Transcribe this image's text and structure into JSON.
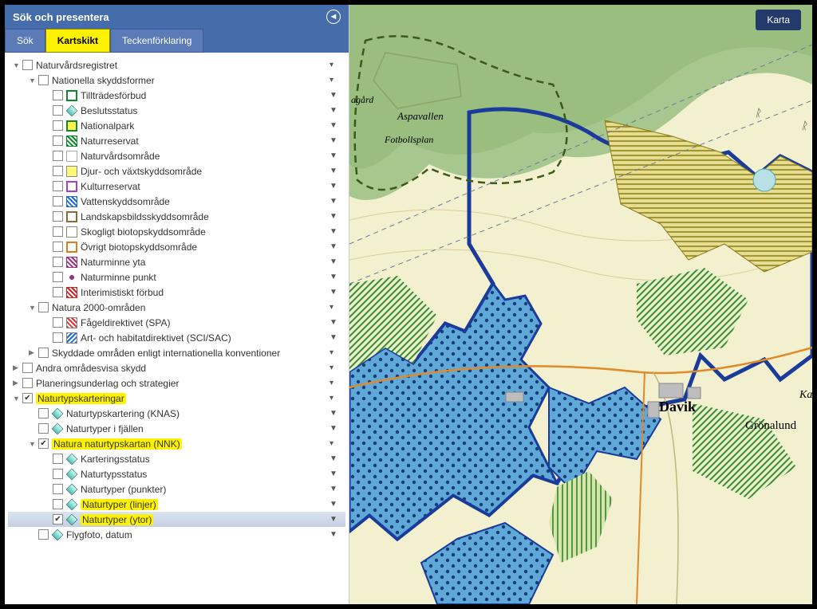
{
  "panel": {
    "title": "Sök och presentera",
    "tabs": {
      "search": "Sök",
      "layers": "Kartskikt",
      "legend": "Teckenförklaring"
    }
  },
  "map": {
    "button": "Karta",
    "labels": {
      "aspavallen": "Aspavallen",
      "fotbollsplan": "Fotbollsplan",
      "davik": "Davik",
      "gronalund": "Grönalund",
      "ka": "Ka",
      "agard": "agård"
    }
  },
  "tree": [
    {
      "lvl": 0,
      "caret": "▼",
      "label": "Naturvårdsregistret",
      "cb": false,
      "sym": "",
      "opts": "▾"
    },
    {
      "lvl": 1,
      "caret": "▼",
      "label": "Nationella skyddsformer",
      "cb": false,
      "sym": "",
      "opts": "▾"
    },
    {
      "lvl": 2,
      "caret": "",
      "label": "Tillträdesförbud",
      "cb": false,
      "sym": "box-green",
      "opts": "▼",
      "symStyle": "background:#fff;border:2px solid #0a8a2a;"
    },
    {
      "lvl": 2,
      "caret": "",
      "label": "Beslutsstatus",
      "cb": false,
      "sym": "diamond",
      "opts": "▼"
    },
    {
      "lvl": 2,
      "caret": "",
      "label": "Nationalpark",
      "cb": false,
      "sym": "box",
      "opts": "▼",
      "symStyle": "background:#fff34a;border:2px solid #0a8a2a;"
    },
    {
      "lvl": 2,
      "caret": "",
      "label": "Naturreservat",
      "cb": false,
      "sym": "box",
      "opts": "▼",
      "symStyle": "background:repeating-linear-gradient(45deg,#0a8a2a 0 2px,#fff 2px 4px);border:1px solid #0a8a2a;"
    },
    {
      "lvl": 2,
      "caret": "",
      "label": "Naturvårdsområde",
      "cb": false,
      "sym": "box",
      "opts": "▼",
      "symStyle": "background:#fff;border:1px solid #aaa;"
    },
    {
      "lvl": 2,
      "caret": "",
      "label": "Djur- och växtskyddsområde",
      "cb": false,
      "sym": "box",
      "opts": "▼",
      "symStyle": "background:#fff97a;"
    },
    {
      "lvl": 2,
      "caret": "",
      "label": "Kulturreservat",
      "cb": false,
      "sym": "box",
      "opts": "▼",
      "symStyle": "background:#fff;border:2px solid #a040d0;"
    },
    {
      "lvl": 2,
      "caret": "",
      "label": "Vattenskyddsområde",
      "cb": false,
      "sym": "box",
      "opts": "▼",
      "symStyle": "background:repeating-linear-gradient(45deg,#1a6ad9 0 2px,#fff 2px 4px);border:1px solid #1a6ad9;"
    },
    {
      "lvl": 2,
      "caret": "",
      "label": "Landskapsbildsskyddsområde",
      "cb": false,
      "sym": "box",
      "opts": "▼",
      "symStyle": "background:#fff;border:2px solid #8a6a3a;"
    },
    {
      "lvl": 2,
      "caret": "",
      "label": "Skogligt biotopskyddsområde",
      "cb": false,
      "sym": "box",
      "opts": "▼",
      "symStyle": "background:#fff;border:1px solid #887;"
    },
    {
      "lvl": 2,
      "caret": "",
      "label": "Övrigt biotopskyddsområde",
      "cb": false,
      "sym": "box",
      "opts": "▼",
      "symStyle": "background:#fff;border:2px solid #e07a1a;"
    },
    {
      "lvl": 2,
      "caret": "",
      "label": "Naturminne yta",
      "cb": false,
      "sym": "box",
      "opts": "▼",
      "symStyle": "background:repeating-linear-gradient(45deg,#a03080 0 2px,#fff 2px 4px);border:1px solid #a03080;"
    },
    {
      "lvl": 2,
      "caret": "",
      "label": "Naturminne punkt",
      "cb": false,
      "sym": "dot",
      "opts": "▼",
      "symStyle": "background:radial-gradient(circle,#a03080 0 3px,transparent 3px);border:none;"
    },
    {
      "lvl": 2,
      "caret": "",
      "label": "Interimistiskt förbud",
      "cb": false,
      "sym": "box",
      "opts": "▼",
      "symStyle": "background:repeating-linear-gradient(45deg,#c22 0 2px,#fff 2px 4px);border:1px solid #c22;"
    },
    {
      "lvl": 1,
      "caret": "▼",
      "label": "Natura 2000-områden",
      "cb": false,
      "sym": "",
      "opts": "▾"
    },
    {
      "lvl": 2,
      "caret": "",
      "label": "Fågeldirektivet (SPA)",
      "cb": false,
      "sym": "box",
      "opts": "▼",
      "symStyle": "background:repeating-linear-gradient(45deg,#d33 0 2px,#fff 2px 4px);"
    },
    {
      "lvl": 2,
      "caret": "",
      "label": "Art- och habitatdirektivet (SCI/SAC)",
      "cb": false,
      "sym": "box",
      "opts": "▼",
      "symStyle": "background:repeating-linear-gradient(-45deg,#1a6ad9 0 2px,#fff 2px 4px);"
    },
    {
      "lvl": 1,
      "caret": "▶",
      "label": "Skyddade områden enligt internationella konventioner",
      "cb": false,
      "sym": "",
      "opts": "▾"
    },
    {
      "lvl": 0,
      "caret": "▶",
      "label": "Andra områdesvisa skydd",
      "cb": false,
      "sym": "",
      "opts": "▾"
    },
    {
      "lvl": 0,
      "caret": "▶",
      "label": "Planeringsunderlag och strategier",
      "cb": false,
      "sym": "",
      "opts": "▾"
    },
    {
      "lvl": 0,
      "caret": "▼",
      "label": "Naturtypskarteringar",
      "cb": true,
      "sym": "",
      "opts": "▾",
      "hl": true
    },
    {
      "lvl": 1,
      "caret": "",
      "label": "Naturtypskartering (KNAS)",
      "cb": false,
      "sym": "diamond",
      "opts": "▼"
    },
    {
      "lvl": 1,
      "caret": "",
      "label": "Naturtyper i fjällen",
      "cb": false,
      "sym": "diamond",
      "opts": "▼"
    },
    {
      "lvl": 1,
      "caret": "▼",
      "label": "Natura naturtypskartan (NNK)",
      "cb": true,
      "sym": "",
      "opts": "▾",
      "hl": true
    },
    {
      "lvl": 2,
      "caret": "",
      "label": "Karteringsstatus",
      "cb": false,
      "sym": "diamond",
      "opts": "▼"
    },
    {
      "lvl": 2,
      "caret": "",
      "label": "Naturtypsstatus",
      "cb": false,
      "sym": "diamond",
      "opts": "▼"
    },
    {
      "lvl": 2,
      "caret": "",
      "label": "Naturtyper (punkter)",
      "cb": false,
      "sym": "diamond",
      "opts": "▼"
    },
    {
      "lvl": 2,
      "caret": "",
      "label": "Naturtyper (linjer)",
      "cb": false,
      "sym": "diamond",
      "opts": "▼",
      "hl": true
    },
    {
      "lvl": 2,
      "caret": "",
      "label": "Naturtyper (ytor)",
      "cb": true,
      "sym": "diamond",
      "opts": "▼",
      "hl": true,
      "sel": true
    },
    {
      "lvl": 1,
      "caret": "",
      "label": "Flygfoto, datum",
      "cb": false,
      "sym": "diamond",
      "opts": "▼"
    }
  ]
}
